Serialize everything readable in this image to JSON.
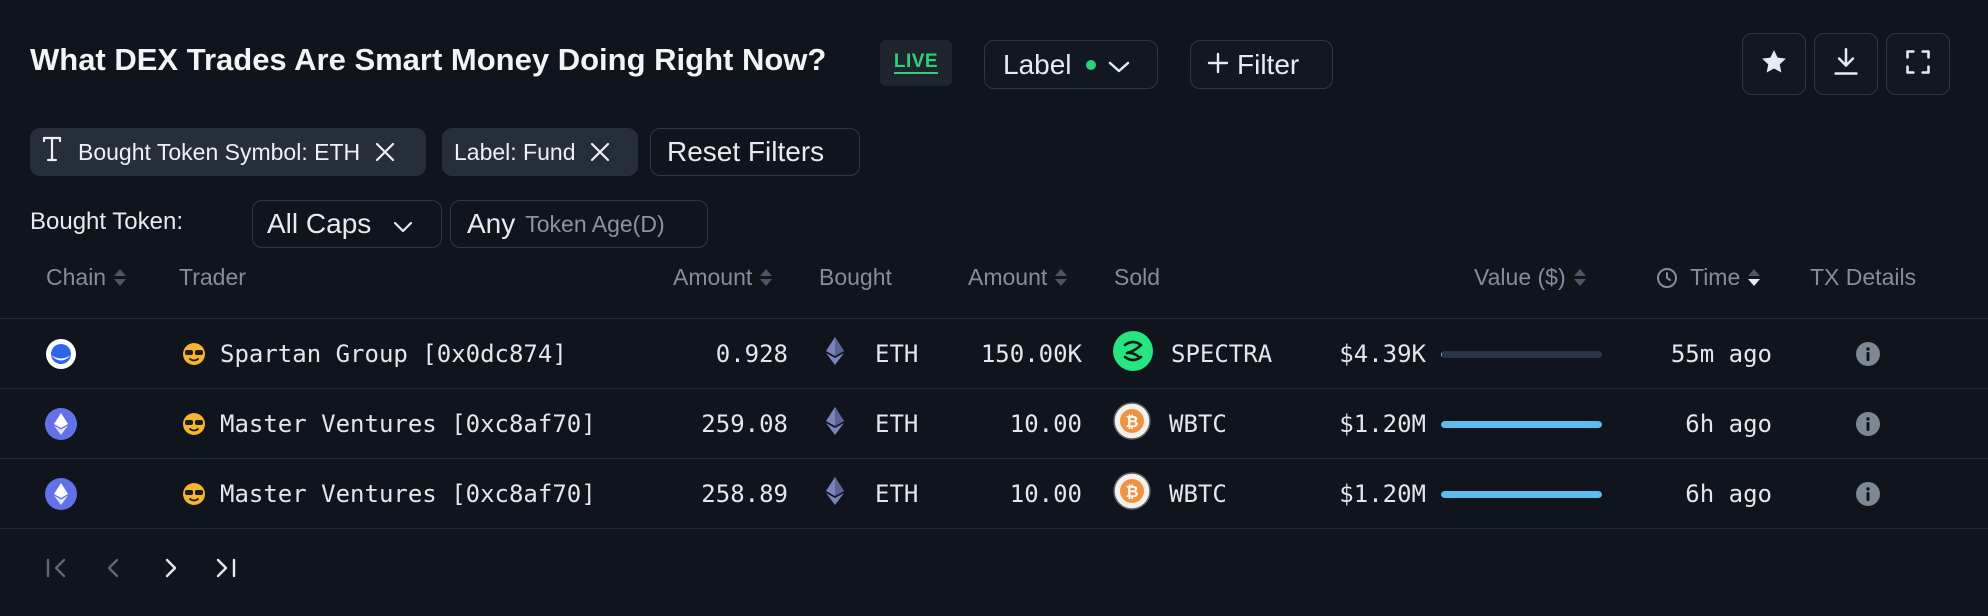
{
  "header": {
    "title": "What DEX Trades Are Smart Money Doing Right Now?",
    "live_badge": "LIVE",
    "label_button": "Label",
    "filter_button": "Filter",
    "actions": [
      "star-icon",
      "download-icon",
      "fullscreen-icon"
    ]
  },
  "active_filters": {
    "chips": [
      {
        "text": "Bought Token Symbol: ETH",
        "icon": "text-type-icon"
      },
      {
        "text": "Label: Fund"
      }
    ],
    "reset_label": "Reset Filters"
  },
  "bought_token_filter": {
    "label": "Bought Token:",
    "caps_value": "All Caps",
    "age_value": "Any",
    "age_placeholder": "Token Age(D)"
  },
  "table": {
    "columns": [
      "Chain",
      "Trader",
      "Amount",
      "Bought",
      "Amount",
      "Sold",
      "Value ($)",
      "Time",
      "TX Details"
    ],
    "rows": [
      {
        "chain": "other-chain-icon",
        "trader": "Spartan Group [0x0dc874]",
        "amount_bought": "0.928",
        "bought": "ETH",
        "amount_sold": "150.00K",
        "sold": "SPECTRA",
        "value": "$4.39K",
        "value_fraction": 0.004,
        "time": "55m ago"
      },
      {
        "chain": "ethereum-icon",
        "trader": "Master Ventures [0xc8af70]",
        "amount_bought": "259.08",
        "bought": "ETH",
        "amount_sold": "10.00",
        "sold": "WBTC",
        "value": "$1.20M",
        "value_fraction": 1.0,
        "time": "6h ago"
      },
      {
        "chain": "ethereum-icon",
        "trader": "Master Ventures [0xc8af70]",
        "amount_bought": "258.89",
        "bought": "ETH",
        "amount_sold": "10.00",
        "sold": "WBTC",
        "value": "$1.20M",
        "value_fraction": 1.0,
        "time": "6h ago"
      }
    ]
  },
  "colors": {
    "background": "#10151d",
    "live_green": "#2fd07a",
    "bar_fill": "#5bbcf0",
    "bar_track": "#2a3545",
    "spectra_green": "#27e57f",
    "wbtc_orange": "#f09242",
    "eth_blue": "#6272e6",
    "emoji_yellow": "#f5b52e"
  }
}
